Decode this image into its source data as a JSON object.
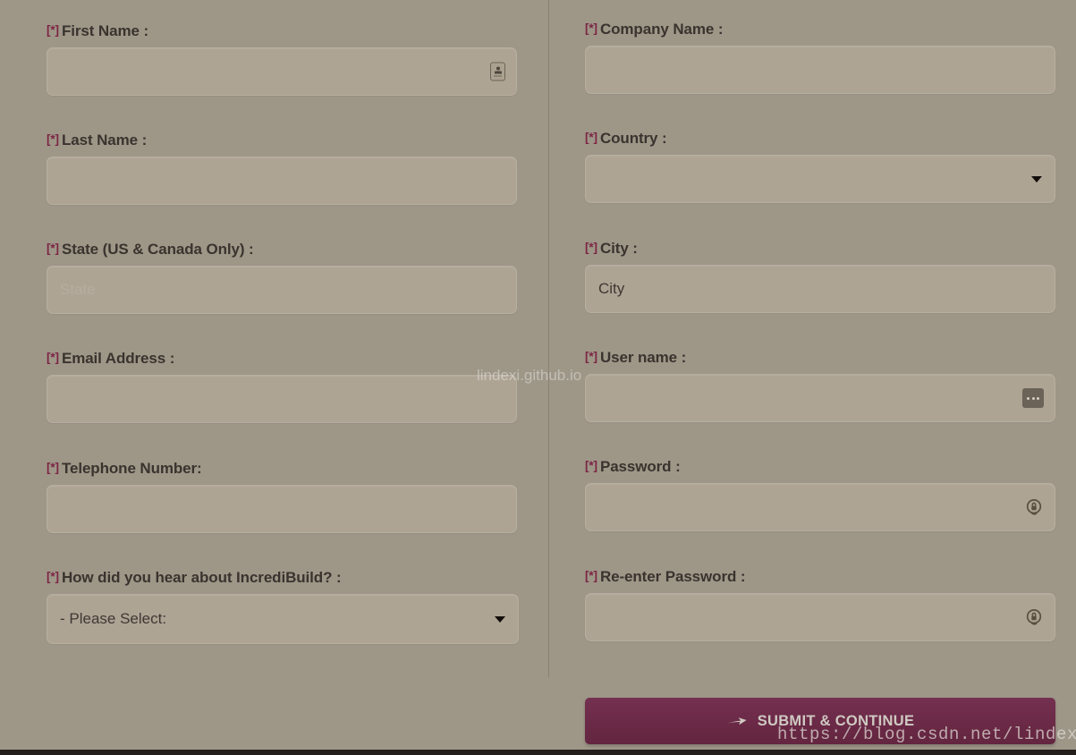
{
  "form": {
    "required_marker": "[*]",
    "left_column": [
      {
        "label": "First Name :",
        "value": "",
        "placeholder": "",
        "icon": "contact-card-icon",
        "type": "text",
        "field_name": "first-name"
      },
      {
        "label": "Last Name :",
        "value": "",
        "placeholder": "",
        "icon": "",
        "type": "text",
        "field_name": "last-name"
      },
      {
        "label": "State (US & Canada Only) :",
        "value": "",
        "placeholder": "State",
        "icon": "",
        "type": "text",
        "field_name": "state"
      },
      {
        "label": "Email Address :",
        "value": "",
        "placeholder": "",
        "icon": "",
        "type": "text",
        "field_name": "email-address"
      },
      {
        "label": "Telephone Number:",
        "value": "",
        "placeholder": "",
        "icon": "",
        "type": "text",
        "field_name": "telephone-number"
      },
      {
        "label": "How did you hear about IncrediBuild? :",
        "value": "- Please Select:",
        "placeholder": "",
        "icon": "chevron-down-icon",
        "type": "select",
        "field_name": "how-did-you-hear"
      }
    ],
    "right_column": [
      {
        "label": "Company Name :",
        "value": "",
        "placeholder": "",
        "icon": "",
        "type": "text",
        "field_name": "company-name"
      },
      {
        "label": "Country :",
        "value": "",
        "placeholder": "",
        "icon": "chevron-down-icon",
        "type": "select",
        "field_name": "country"
      },
      {
        "label": "City :",
        "value": "City",
        "placeholder": "",
        "icon": "",
        "type": "text",
        "field_name": "city"
      },
      {
        "label": "User name :",
        "value": "",
        "placeholder": "",
        "icon": "ellipsis-icon",
        "type": "text",
        "field_name": "user-name"
      },
      {
        "label": "Password :",
        "value": "",
        "placeholder": "",
        "icon": "lock-icon",
        "type": "password",
        "field_name": "password"
      },
      {
        "label": "Re-enter Password :",
        "value": "",
        "placeholder": "",
        "icon": "lock-icon",
        "type": "password",
        "field_name": "re-enter-password"
      }
    ]
  },
  "submit": {
    "label": "SUBMIT & CONTINUE",
    "icon": "arrow-right-icon"
  },
  "watermarks": {
    "center": "lindexi.github.io",
    "url": "https://blog.csdn.net/lindexi_gd"
  },
  "colors": {
    "page_background": "#9e9788",
    "input_background": "#aea494",
    "input_border": "#b7ae9f",
    "label_text": "#3a332e",
    "required_marker": "#7c2443",
    "submit_background": "#6b2a45",
    "submit_text": "#cfc9c2",
    "placeholder_text": "#b6ad9f"
  }
}
